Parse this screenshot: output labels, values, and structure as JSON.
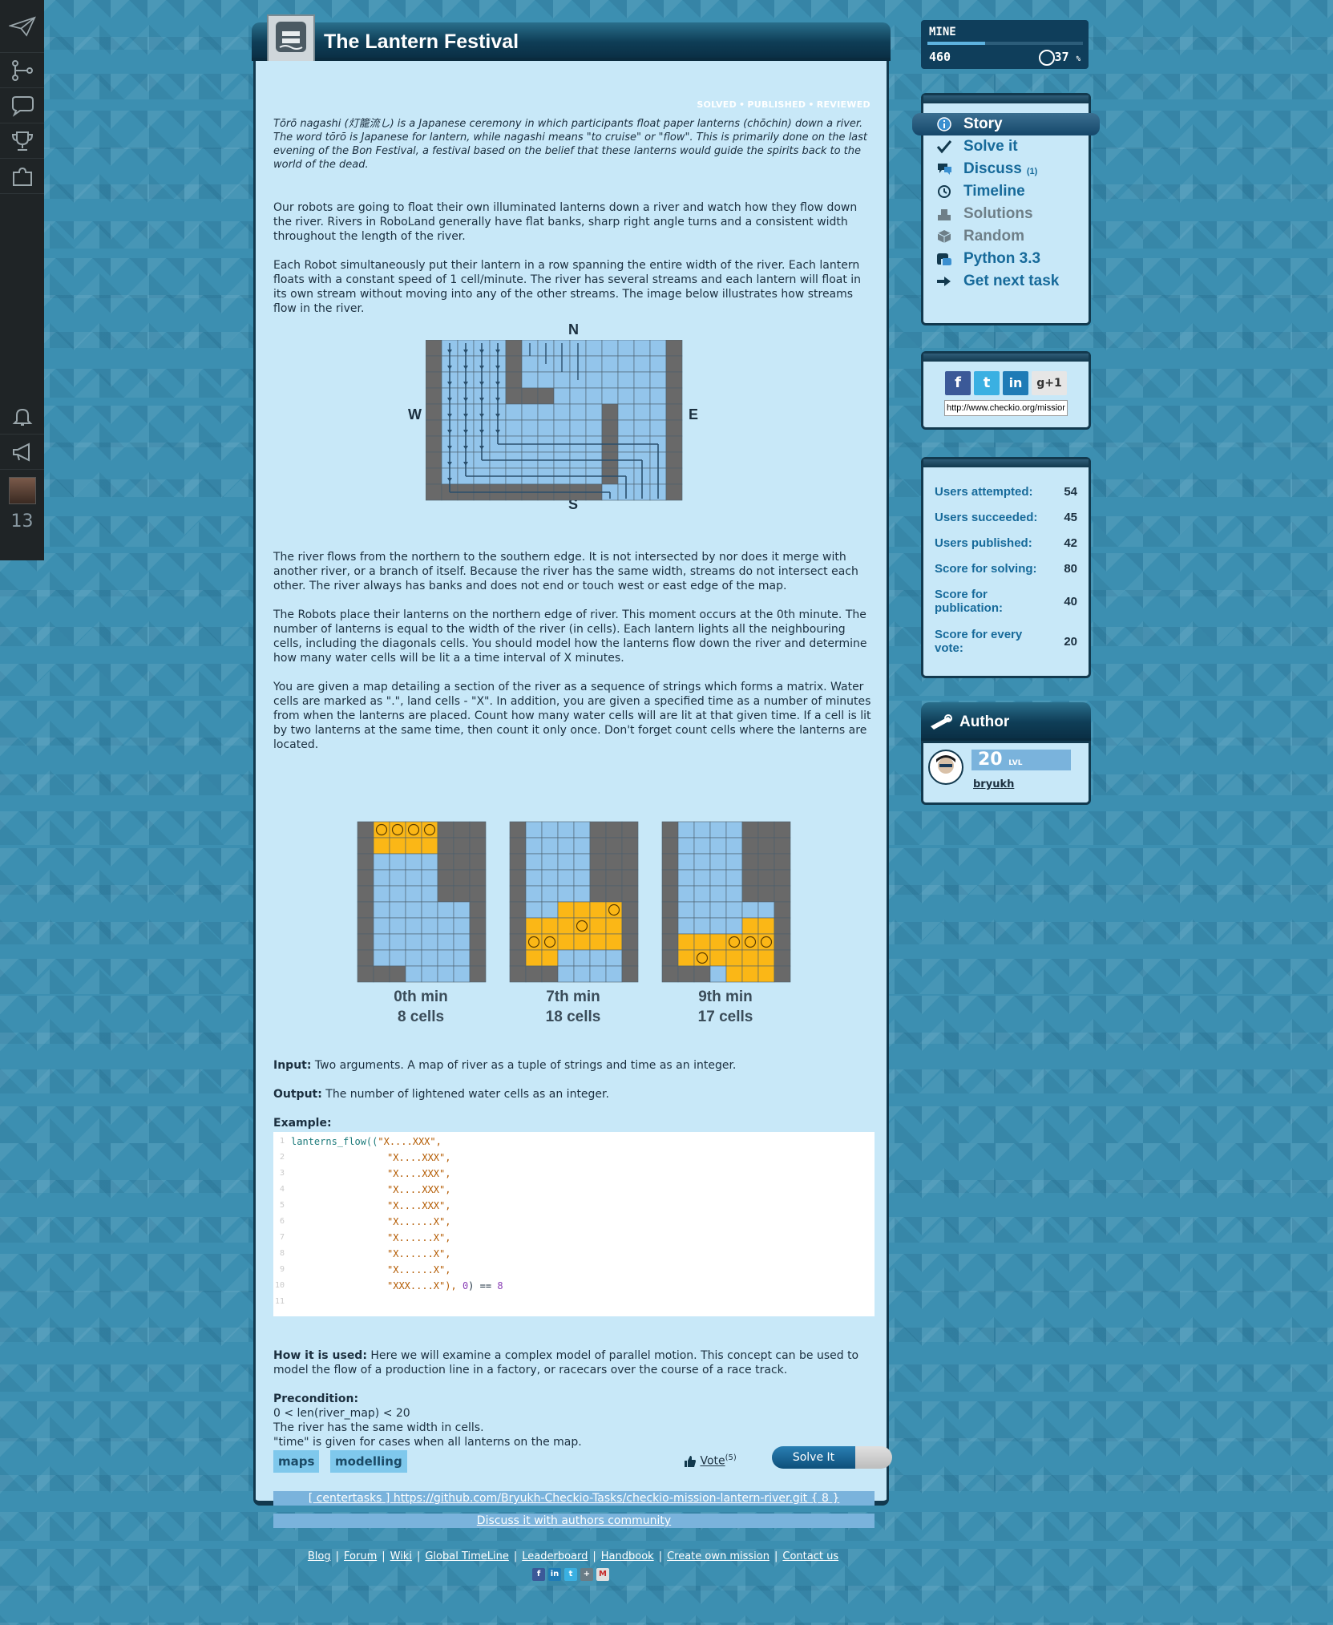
{
  "rail": {
    "count": "13"
  },
  "main": {
    "title": "The Lantern Festival",
    "status": [
      "SOLVED",
      "PUBLISHED",
      "REVIEWED"
    ],
    "status_sep": "•",
    "intro_italic": "Tōrō nagashi (灯籠流し) is a Japanese ceremony in which participants float paper lanterns (chōchin) down a river. The word tōrō is Japanese for lantern, while nagashi means \"to cruise\" or \"flow\". This is primarily done on the last evening of the Bon Festival, a festival based on the belief that these lanterns would guide the spirits back to the world of the dead.",
    "p1": "Our robots are going to float their own illuminated lanterns down a river and watch how they flow down the river. Rivers in RoboLand generally have flat banks, sharp right angle turns and a consistent width throughout the length of the river.",
    "p2": "Each Robot simultaneously put their lantern in a row spanning the entire width of the river. Each lantern floats with a constant speed of 1 cell/minute. The river has several streams and each lantern will float in its own stream without moving into any of the other streams. The image below illustrates how streams flow in the river.",
    "compass": {
      "n": "N",
      "s": "S",
      "w": "W",
      "e": "E"
    },
    "p3": "The river flows from the northern to the southern edge. It is not intersected by nor does it merge with another river, or a branch of itself. Because the river has the same width, streams do not intersect each other. The river always has banks and does not end or touch west or east edge of the map.",
    "p4": "The Robots place their lanterns on the northern edge of river. This moment occurs at the 0th minute. The number of lanterns is equal to the width of the river (in cells). Each lantern lights all the neighbouring cells, including the diagonals cells. You should model how the lanterns flow down the river and determine how many water cells will be lit a a time interval of X minutes.",
    "p5": "You are given a map detailing a section of the river as a sequence of strings which forms a matrix. Water cells are marked as \".\", land cells - \"X\". In addition, you are given a specified time as a number of minutes from when the lanterns are placed. Count how many water cells will are lit at that given time. If a cell is lit by two lanterns at the same time, then count it only once. Don't forget count cells where the lanterns are located.",
    "grids": [
      {
        "min": "0th min",
        "cells": "8 cells"
      },
      {
        "min": "7th min",
        "cells": "18 cells"
      },
      {
        "min": "9th min",
        "cells": "17 cells"
      }
    ],
    "input_label": "Input:",
    "input_text": " Two arguments. A map of river as a tuple of strings and time as an integer.",
    "output_label": "Output:",
    "output_text": " The number of lightened water cells as an integer.",
    "example_label": "Example:",
    "code": {
      "fn": "lanterns_flow((",
      "rows": [
        "\"X....XXX\",",
        "\"X....XXX\",",
        "\"X....XXX\",",
        "\"X....XXX\",",
        "\"X....XXX\",",
        "\"X......X\",",
        "\"X......X\",",
        "\"X......X\",",
        "\"X......X\",",
        "\"XXX....X\"),"
      ],
      "tail_num": "0",
      "tail_op": ") ==",
      "tail_res": "8",
      "line_numbers": [
        "1",
        "2",
        "3",
        "4",
        "5",
        "6",
        "7",
        "8",
        "9",
        "10",
        "11"
      ]
    },
    "how_label": "How it is used:",
    "how_text": " Here we will examine a complex model of parallel motion. This concept can be used to model the flow of a production line in a factory, or racecars over the course of a race track.",
    "pre_label": "Precondition:",
    "pre_lines": [
      "0 < len(river_map) < 20",
      "The river has the same width in cells.",
      "\"time\" is given for cases when all lanterns on the map."
    ],
    "tags": [
      "maps",
      "modelling"
    ],
    "vote_label": "Vote",
    "vote_count": "(5)",
    "solve_button": "Solve It",
    "repo_link": "[ centertasks ] https://github.com/Bryukh-Checkio-Tasks/checkio-mission-lantern-river.git { 8 }",
    "discuss_link": "Discuss it with authors community"
  },
  "mine": {
    "title": "MINE",
    "score": "460",
    "percent": "37",
    "percent_unit": "%",
    "progress": 0.37
  },
  "menu": [
    {
      "label": "Story",
      "icon": "info-icon"
    },
    {
      "label": "Solve it",
      "icon": "check-icon"
    },
    {
      "label": "Discuss",
      "count": "(1)",
      "icon": "discuss-icon"
    },
    {
      "label": "Timeline",
      "icon": "clock-icon"
    },
    {
      "label": "Solutions",
      "icon": "solutions-icon"
    },
    {
      "label": "Random",
      "icon": "cube-icon"
    },
    {
      "label": "Python 3.3",
      "icon": "python-icon"
    },
    {
      "label": "Get next task",
      "icon": "arrow-icon"
    }
  ],
  "share": {
    "url": "http://www.checkio.org/mission/lantern-river/"
  },
  "stats": [
    {
      "label": "Users attempted:",
      "value": "54"
    },
    {
      "label": "Users succeeded:",
      "value": "45"
    },
    {
      "label": "Users published:",
      "value": "42"
    },
    {
      "label": "Score for solving:",
      "value": "80"
    },
    {
      "label": "Score for publication:",
      "value": "40"
    },
    {
      "label": "Score for every vote:",
      "value": "20"
    }
  ],
  "author": {
    "title": "Author",
    "level": "20",
    "level_unit": "LVL",
    "name": "bryukh"
  },
  "footer": {
    "links": [
      "Blog",
      "Forum",
      "Wiki",
      "Global TimeLine",
      "Leaderboard",
      "Handbook",
      "Create own mission",
      "Contact us"
    ],
    "sep": "|"
  },
  "colors": {
    "water": "#93c5eb",
    "land": "#696969",
    "lit": "#fbb716",
    "panel": "#c8e8f8",
    "accent": "#176a9a"
  }
}
